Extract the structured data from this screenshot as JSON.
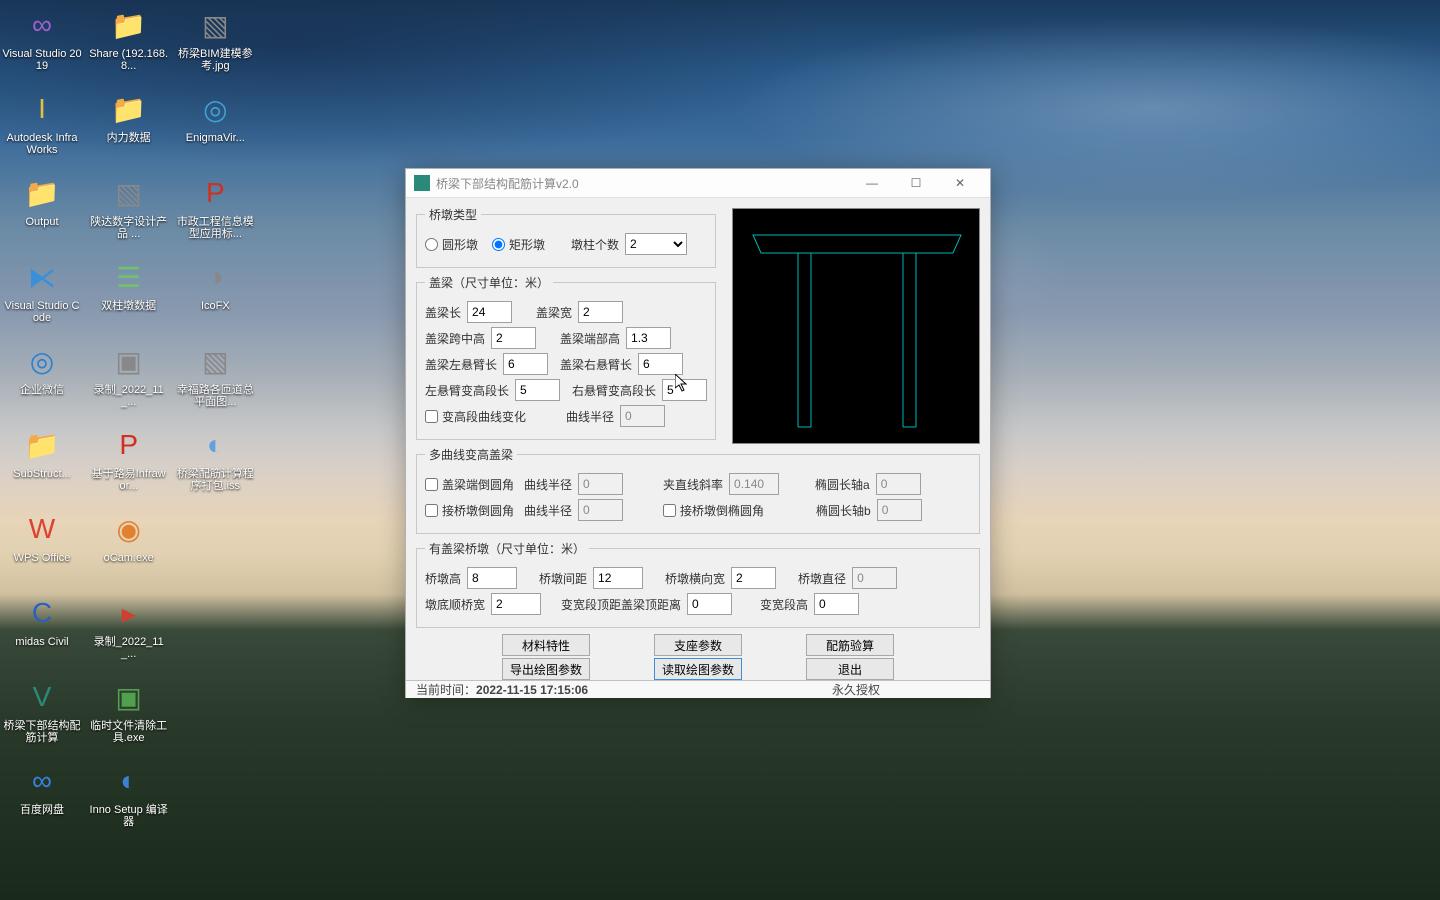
{
  "desktop_icons": [
    {
      "label": "Visual Studio 2019",
      "glyph": "∞",
      "color": "#a060d0"
    },
    {
      "label": "Autodesk InfraWorks",
      "glyph": "I",
      "color": "#e0c040"
    },
    {
      "label": "Output",
      "glyph": "📁",
      "color": "#f0d070"
    },
    {
      "label": "Visual Studio Code",
      "glyph": "⧔",
      "color": "#3a8fd8"
    },
    {
      "label": "企业微信",
      "glyph": "◎",
      "color": "#2a80d0"
    },
    {
      "label": "SubStruct...",
      "glyph": "📁",
      "color": "#f0d070"
    },
    {
      "label": "WPS Office",
      "glyph": "W",
      "color": "#e04030"
    },
    {
      "label": "midas Civil",
      "glyph": "C",
      "color": "#2a60c0"
    },
    {
      "label": "桥梁下部结构配筋计算",
      "glyph": "V",
      "color": "#2a8a7a"
    },
    {
      "label": "百度网盘",
      "glyph": "∞",
      "color": "#3a80e0"
    },
    {
      "label": "Share (192.168.8...",
      "glyph": "📁",
      "color": "#f0d070"
    },
    {
      "label": "内力数据",
      "glyph": "📁",
      "color": "#f0d070"
    },
    {
      "label": "陕达数字设计产品 ...",
      "glyph": "▧",
      "color": "#888"
    },
    {
      "label": "双柱墩数据",
      "glyph": "☰",
      "color": "#70c070"
    },
    {
      "label": "录制_2022_11_...",
      "glyph": "▣",
      "color": "#888"
    },
    {
      "label": "基于路易Infrawor...",
      "glyph": "P",
      "color": "#d03020"
    },
    {
      "label": "oCam.exe",
      "glyph": "◉",
      "color": "#e08030"
    },
    {
      "label": "录制_2022_11_...",
      "glyph": "▸",
      "color": "#d04030"
    },
    {
      "label": "临时文件清除工具.exe",
      "glyph": "▣",
      "color": "#50a050"
    },
    {
      "label": "Inno Setup 编译器",
      "glyph": "◐",
      "color": "#4080d0"
    },
    {
      "label": "桥梁BIM建模参考.jpg",
      "glyph": "▧",
      "color": "#888"
    },
    {
      "label": "EnigmaVir...",
      "glyph": "◎",
      "color": "#40a0d0"
    },
    {
      "label": "市政工程信息模型应用标...",
      "glyph": "P",
      "color": "#d03020"
    },
    {
      "label": "IcoFX",
      "glyph": "◑",
      "color": "#888"
    },
    {
      "label": "幸福路各匝道总平面图...",
      "glyph": "▧",
      "color": "#888"
    },
    {
      "label": "桥梁配筋计算程序打包.iss",
      "glyph": "◐",
      "color": "#60a0e0"
    }
  ],
  "win": {
    "title": "桥梁下部结构配筋计算v2.0",
    "pier_type_group": "桥墩类型",
    "radio_round": "圆形墩",
    "radio_rect": "矩形墩",
    "pier_count_label": "墩柱个数",
    "pier_count_value": "2",
    "capbeam_group": "盖梁（尺寸单位：米）",
    "cap_len": "盖梁长",
    "cap_len_v": "24",
    "cap_w": "盖梁宽",
    "cap_w_v": "2",
    "cap_mid_h": "盖梁跨中高",
    "cap_mid_h_v": "2",
    "cap_end_h": "盖梁端部高",
    "cap_end_h_v": "1.3",
    "cap_lcant": "盖梁左悬臂长",
    "cap_lcant_v": "6",
    "cap_rcant": "盖梁右悬臂长",
    "cap_rcant_v": "6",
    "lvar": "左悬臂变高段长",
    "lvar_v": "5",
    "rvar": "右悬臂变高段长",
    "rvar_v": "5",
    "curve_chk": "变高段曲线变化",
    "curve_r": "曲线半径",
    "curve_r_v": "0",
    "multi_group": "多曲线变高盖梁",
    "end_fillet": "盖梁端倒圆角",
    "end_r": "曲线半径",
    "end_r_v": "0",
    "slope": "夹直线斜率",
    "slope_v": "0.140",
    "ell_a": "椭圆长轴a",
    "ell_a_v": "0",
    "pier_fillet": "接桥墩倒圆角",
    "pier_r": "曲线半径",
    "pier_r_v": "0",
    "pier_ell": "接桥墩倒椭圆角",
    "ell_b": "椭圆长轴b",
    "ell_b_v": "0",
    "pier_group": "有盖梁桥墩（尺寸单位：米）",
    "pier_h": "桥墩高",
    "pier_h_v": "8",
    "pier_sp": "桥墩间距",
    "pier_sp_v": "12",
    "pier_tw": "桥墩横向宽",
    "pier_tw_v": "2",
    "pier_d": "桥墩直径",
    "pier_d_v": "0",
    "pier_bw": "墩底顺桥宽",
    "pier_bw_v": "2",
    "var_top": "变宽段顶距盖梁顶距离",
    "var_top_v": "0",
    "var_h": "变宽段高",
    "var_h_v": "0",
    "btn_mat": "材料特性",
    "btn_bear": "支座参数",
    "btn_calc": "配筋验算",
    "btn_exp": "导出绘图参数",
    "btn_imp": "读取绘图参数",
    "btn_exit": "退出",
    "status_time_label": "当前时间：",
    "status_time": "2022-11-15 17:15:06",
    "status_lic": "永久授权"
  }
}
